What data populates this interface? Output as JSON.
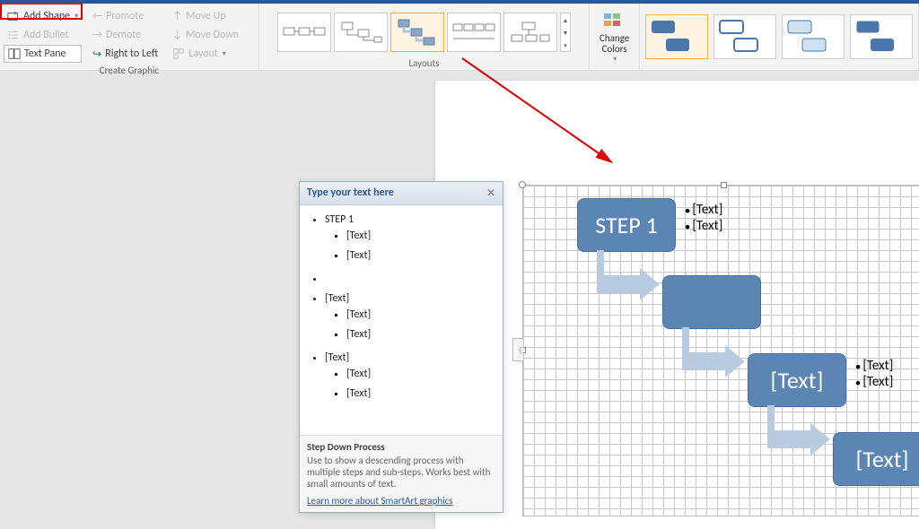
{
  "ribbon": {
    "create_graphic_label": "Create Graphic",
    "add_shape": "Add Shape",
    "add_bullet": "Add Bullet",
    "text_pane": "Text Pane",
    "promote": "Promote",
    "demote": "Demote",
    "right_to_left": "Right to Left",
    "move_up": "Move Up",
    "move_down": "Move Down",
    "layout": "Layout",
    "layouts_label": "Layouts",
    "change_colors": "Change\nColors"
  },
  "textpane": {
    "header": "Type your text here",
    "items": {
      "l1a": "STEP 1",
      "l2a": "[Text]",
      "l2b": "[Text]",
      "l1b": "",
      "l1c": "[Text]",
      "l2c": "[Text]",
      "l2d": "[Text]",
      "l1d": "[Text]",
      "l2e": "[Text]",
      "l2f": "[Text]"
    },
    "footer_title": "Step Down Process",
    "footer_desc": "Use to show a descending process with multiple steps and sub-steps. Works best with small amounts of text.",
    "footer_link": "Learn more about SmartArt graphics"
  },
  "diagram": {
    "step1": "STEP 1",
    "step3": "[Text]",
    "step4": "[Text]",
    "bullets": {
      "b1": "[Text]",
      "b2": "[Text]",
      "b3": "[Text]",
      "b4": "[Text]"
    }
  }
}
